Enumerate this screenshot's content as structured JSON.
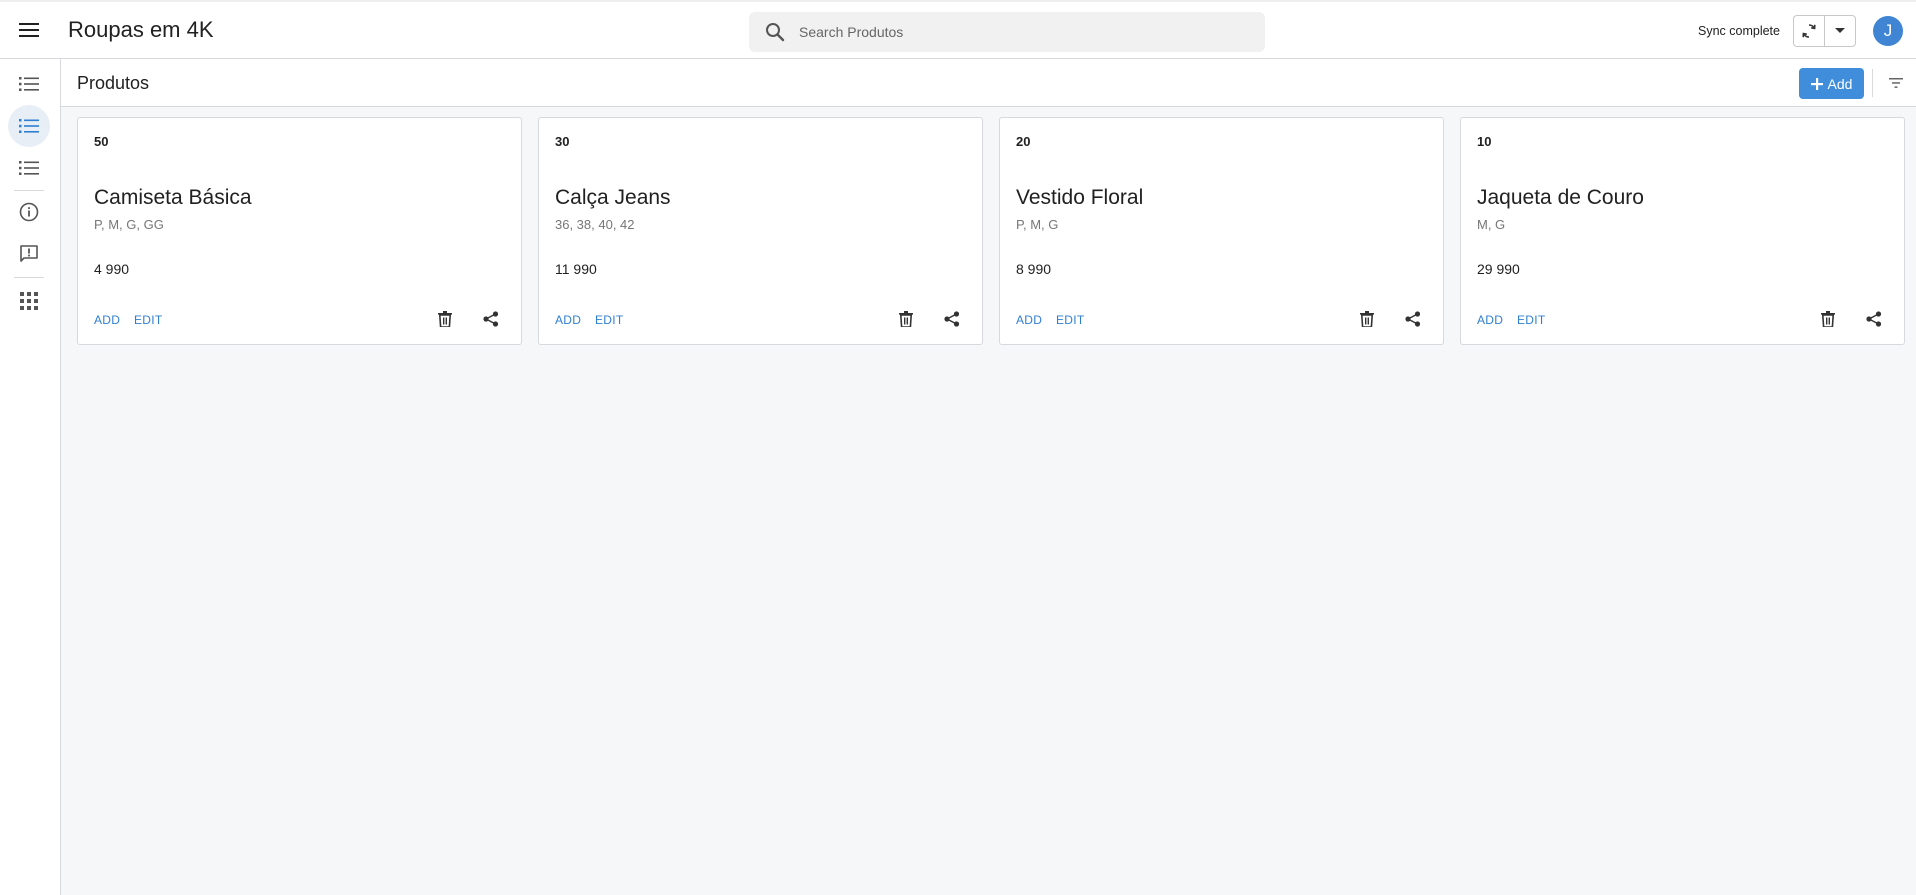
{
  "header": {
    "title": "Roupas em 4K",
    "menu_icon": "hamburger-menu-icon",
    "search": {
      "placeholder": "Search Produtos",
      "value": ""
    },
    "sync_status": "Sync complete",
    "user_initial": "J",
    "avatar_color": "#3f85d3"
  },
  "sidebar": {
    "items": [
      {
        "icon": "list-icon",
        "active": false
      },
      {
        "icon": "list-icon",
        "active": true
      },
      {
        "icon": "list-icon",
        "active": false
      },
      {
        "icon": "info-icon",
        "active": false
      },
      {
        "icon": "feedback-icon",
        "active": false
      },
      {
        "icon": "apps-grid-icon",
        "active": false
      }
    ]
  },
  "toolbar": {
    "title": "Produtos",
    "add_label": "Add",
    "accent_color": "#3f8ddb"
  },
  "products": [
    {
      "quantity": "50",
      "name": "Camiseta Básica",
      "sizes": "P, M, G, GG",
      "price": "4 990",
      "add_label": "ADD",
      "edit_label": "EDIT"
    },
    {
      "quantity": "30",
      "name": "Calça Jeans",
      "sizes": "36, 38, 40, 42",
      "price": "11 990",
      "add_label": "ADD",
      "edit_label": "EDIT"
    },
    {
      "quantity": "20",
      "name": "Vestido Floral",
      "sizes": "P, M, G",
      "price": "8 990",
      "add_label": "ADD",
      "edit_label": "EDIT"
    },
    {
      "quantity": "10",
      "name": "Jaqueta de Couro",
      "sizes": "M, G",
      "price": "29 990",
      "add_label": "ADD",
      "edit_label": "EDIT"
    }
  ]
}
